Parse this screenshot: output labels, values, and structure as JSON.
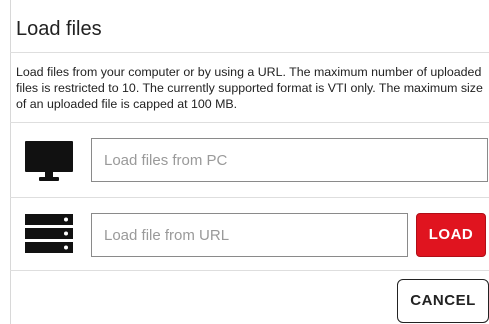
{
  "dialog": {
    "title": "Load files",
    "description": "Load files from your computer or by using a URL. The maximum number of uploaded files is restricted to 10. The currently supported format is VTI only. The maximum size of an uploaded file is capped at 100 MB."
  },
  "pc_row": {
    "icon": "monitor-icon",
    "placeholder": "Load files from PC",
    "value": ""
  },
  "url_row": {
    "icon": "server-icon",
    "placeholder": "Load file from URL",
    "value": "",
    "load_label": "LOAD"
  },
  "footer": {
    "cancel_label": "CANCEL"
  },
  "colors": {
    "load_button": "#e0141f",
    "text": "#222222",
    "placeholder": "#9a9a9a"
  }
}
